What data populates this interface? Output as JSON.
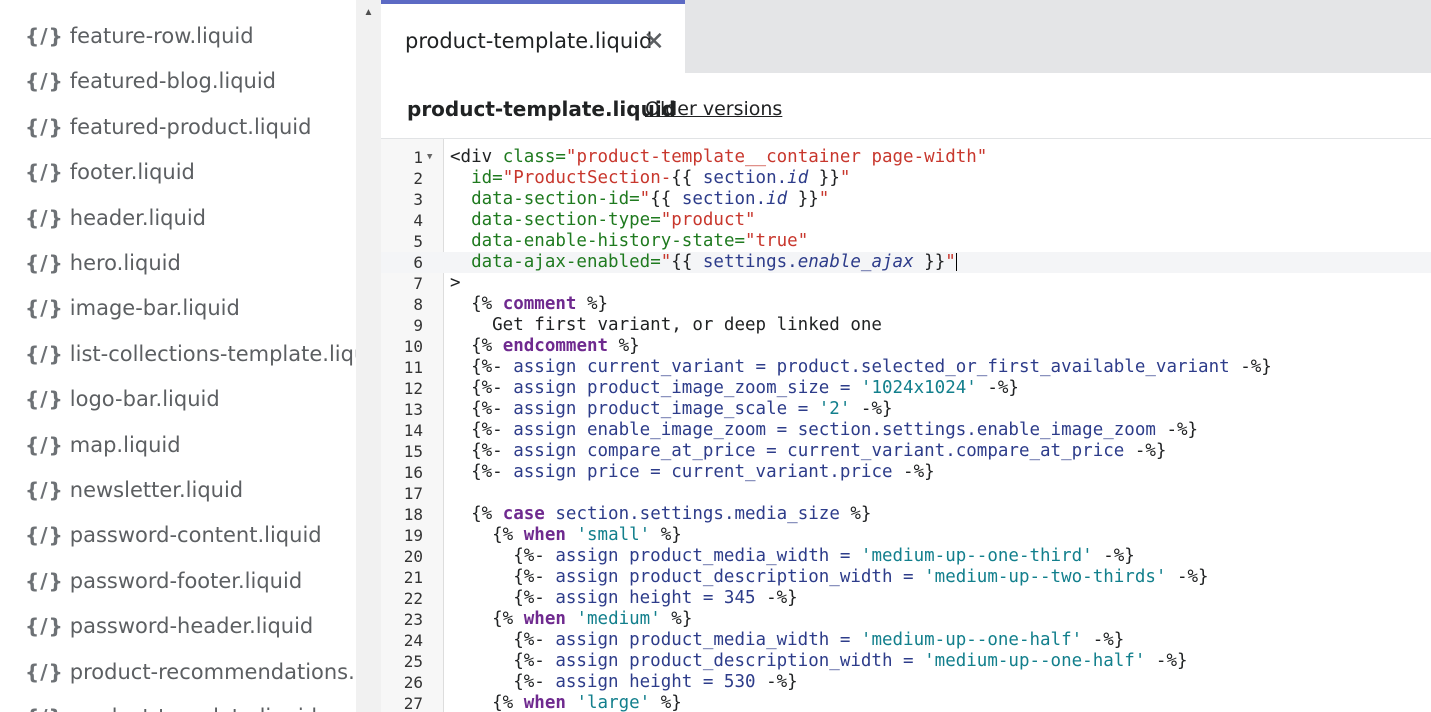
{
  "sidebar": {
    "icon_text": "{/}",
    "items": [
      {
        "label": "feature-row.liquid"
      },
      {
        "label": "featured-blog.liquid"
      },
      {
        "label": "featured-product.liquid"
      },
      {
        "label": "footer.liquid"
      },
      {
        "label": "header.liquid"
      },
      {
        "label": "hero.liquid"
      },
      {
        "label": "image-bar.liquid"
      },
      {
        "label": "list-collections-template.liquid"
      },
      {
        "label": "logo-bar.liquid"
      },
      {
        "label": "map.liquid"
      },
      {
        "label": "newsletter.liquid"
      },
      {
        "label": "password-content.liquid"
      },
      {
        "label": "password-footer.liquid"
      },
      {
        "label": "password-header.liquid"
      },
      {
        "label": "product-recommendations.liquid"
      },
      {
        "label": "product-template.liquid"
      }
    ]
  },
  "tab": {
    "label": "product-template.liquid",
    "close": "✕"
  },
  "header": {
    "title": "product-template.liquid",
    "older_versions": "Older versions"
  },
  "editor": {
    "active_line": 6,
    "lines": [
      [
        [
          "t",
          "<div "
        ],
        [
          "attr",
          "class="
        ],
        [
          "str",
          "\"product-template__container page-width\""
        ]
      ],
      [
        [
          "t",
          "  "
        ],
        [
          "attr",
          "id="
        ],
        [
          "str",
          "\"ProductSection-"
        ],
        [
          "t",
          "{{ "
        ],
        [
          "var",
          "section."
        ],
        [
          "vari",
          "id"
        ],
        [
          "t",
          " }}"
        ],
        [
          "str",
          "\""
        ]
      ],
      [
        [
          "t",
          "  "
        ],
        [
          "attr",
          "data-section-id="
        ],
        [
          "str",
          "\""
        ],
        [
          "t",
          "{{ "
        ],
        [
          "var",
          "section."
        ],
        [
          "vari",
          "id"
        ],
        [
          "t",
          " }}"
        ],
        [
          "str",
          "\""
        ]
      ],
      [
        [
          "t",
          "  "
        ],
        [
          "attr",
          "data-section-type="
        ],
        [
          "str",
          "\"product\""
        ]
      ],
      [
        [
          "t",
          "  "
        ],
        [
          "attr",
          "data-enable-history-state="
        ],
        [
          "str",
          "\"true\""
        ]
      ],
      [
        [
          "t",
          "  "
        ],
        [
          "attr",
          "data-ajax-enabled="
        ],
        [
          "str",
          "\""
        ],
        [
          "t",
          "{{ "
        ],
        [
          "var",
          "settings."
        ],
        [
          "vari",
          "enable_ajax"
        ],
        [
          "t",
          " }}"
        ],
        [
          "str",
          "\""
        ]
      ],
      [
        [
          "t",
          ">"
        ]
      ],
      [
        [
          "t",
          "  {% "
        ],
        [
          "kw",
          "comment"
        ],
        [
          "t",
          " %}"
        ]
      ],
      [
        [
          "t",
          "    Get first variant, or deep linked one"
        ]
      ],
      [
        [
          "t",
          "  {% "
        ],
        [
          "kw",
          "endcomment"
        ],
        [
          "t",
          " %}"
        ]
      ],
      [
        [
          "t",
          "  {%- "
        ],
        [
          "var",
          "assign current_variant = product.selected_or_first_available_variant"
        ],
        [
          "t",
          " -%}"
        ]
      ],
      [
        [
          "t",
          "  {%- "
        ],
        [
          "var",
          "assign product_image_zoom_size = "
        ],
        [
          "str2",
          "'1024x1024'"
        ],
        [
          "t",
          " -%}"
        ]
      ],
      [
        [
          "t",
          "  {%- "
        ],
        [
          "var",
          "assign product_image_scale = "
        ],
        [
          "str2",
          "'2'"
        ],
        [
          "t",
          " -%}"
        ]
      ],
      [
        [
          "t",
          "  {%- "
        ],
        [
          "var",
          "assign enable_image_zoom = section.settings.enable_image_zoom"
        ],
        [
          "t",
          " -%}"
        ]
      ],
      [
        [
          "t",
          "  {%- "
        ],
        [
          "var",
          "assign compare_at_price = current_variant.compare_at_price"
        ],
        [
          "t",
          " -%}"
        ]
      ],
      [
        [
          "t",
          "  {%- "
        ],
        [
          "var",
          "assign price = current_variant.price"
        ],
        [
          "t",
          " -%}"
        ]
      ],
      [
        [
          "t",
          ""
        ]
      ],
      [
        [
          "t",
          "  {% "
        ],
        [
          "kw",
          "case"
        ],
        [
          "var",
          " section.settings.media_size"
        ],
        [
          "t",
          " %}"
        ]
      ],
      [
        [
          "t",
          "    {% "
        ],
        [
          "kw",
          "when"
        ],
        [
          "t",
          " "
        ],
        [
          "str2",
          "'small'"
        ],
        [
          "t",
          " %}"
        ]
      ],
      [
        [
          "t",
          "      {%- "
        ],
        [
          "var",
          "assign product_media_width = "
        ],
        [
          "str2",
          "'medium-up--one-third'"
        ],
        [
          "t",
          " -%}"
        ]
      ],
      [
        [
          "t",
          "      {%- "
        ],
        [
          "var",
          "assign product_description_width = "
        ],
        [
          "str2",
          "'medium-up--two-thirds'"
        ],
        [
          "t",
          " -%}"
        ]
      ],
      [
        [
          "t",
          "      {%- "
        ],
        [
          "var",
          "assign height = 345"
        ],
        [
          "t",
          " -%}"
        ]
      ],
      [
        [
          "t",
          "    {% "
        ],
        [
          "kw",
          "when"
        ],
        [
          "t",
          " "
        ],
        [
          "str2",
          "'medium'"
        ],
        [
          "t",
          " %}"
        ]
      ],
      [
        [
          "t",
          "      {%- "
        ],
        [
          "var",
          "assign product_media_width = "
        ],
        [
          "str2",
          "'medium-up--one-half'"
        ],
        [
          "t",
          " -%}"
        ]
      ],
      [
        [
          "t",
          "      {%- "
        ],
        [
          "var",
          "assign product_description_width = "
        ],
        [
          "str2",
          "'medium-up--one-half'"
        ],
        [
          "t",
          " -%}"
        ]
      ],
      [
        [
          "t",
          "      {%- "
        ],
        [
          "var",
          "assign height = 530"
        ],
        [
          "t",
          " -%}"
        ]
      ],
      [
        [
          "t",
          "    {% "
        ],
        [
          "kw",
          "when"
        ],
        [
          "t",
          " "
        ],
        [
          "str2",
          "'large'"
        ],
        [
          "t",
          " %}"
        ]
      ]
    ]
  }
}
